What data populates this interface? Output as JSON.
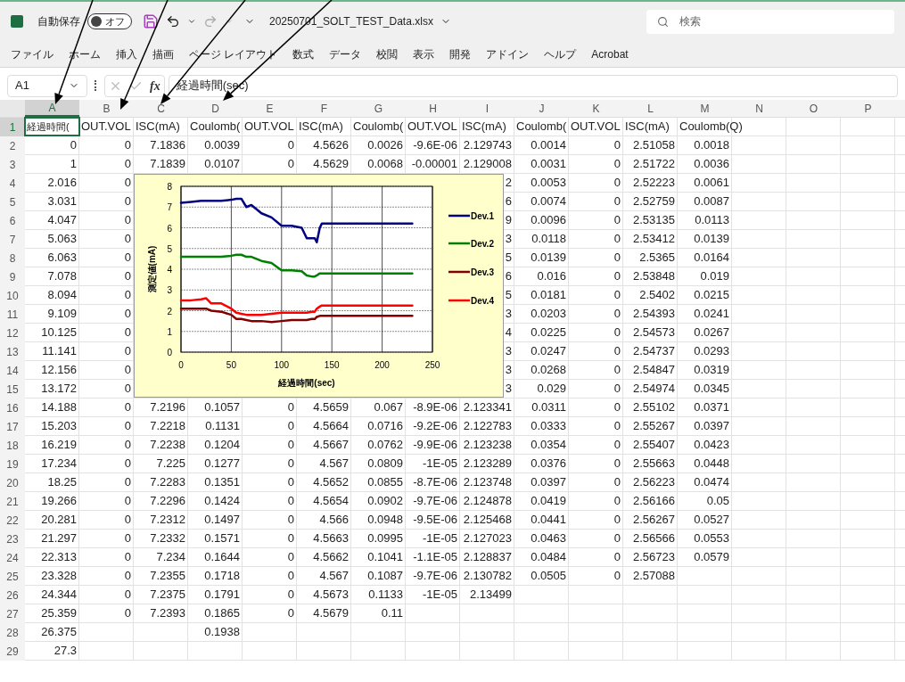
{
  "app": {
    "autosave_label": "自動保存",
    "autosave": {
      "on": false,
      "label": "オフ"
    },
    "file_name": "20250701_SOLT_TEST_Data.xlsx",
    "search_placeholder": "検索"
  },
  "menu": [
    "ファイル",
    "ホーム",
    "挿入",
    "描画",
    "ページ レイアウト",
    "数式",
    "データ",
    "校閲",
    "表示",
    "開発",
    "アドイン",
    "ヘルプ",
    "Acrobat"
  ],
  "formula_bar": {
    "cell_ref": "A1",
    "fx": "fx",
    "value": "経過時間(sec)"
  },
  "columns": [
    {
      "label": "A",
      "selected": true
    },
    {
      "label": "B",
      "selected": false
    },
    {
      "label": "C",
      "selected": false
    },
    {
      "label": "D",
      "selected": false
    },
    {
      "label": "E",
      "selected": false
    },
    {
      "label": "F",
      "selected": false
    },
    {
      "label": "G",
      "selected": false
    },
    {
      "label": "H",
      "selected": false
    },
    {
      "label": "I",
      "selected": false
    },
    {
      "label": "J",
      "selected": false
    },
    {
      "label": "K",
      "selected": false
    },
    {
      "label": "L",
      "selected": false
    },
    {
      "label": "M",
      "selected": false
    },
    {
      "label": "N",
      "selected": false
    },
    {
      "label": "O",
      "selected": false
    },
    {
      "label": "P",
      "selected": false
    }
  ],
  "rows": [
    {
      "label": "1",
      "selected": true,
      "kind": "header",
      "cells": [
        "経過時間(",
        "OUT.VOL",
        "ISC(mA)",
        "Coulomb(",
        "OUT.VOL",
        "ISC(mA)",
        "Coulomb(",
        "OUT.VOL",
        "ISC(mA)",
        "Coulomb(",
        "OUT.VOL",
        "ISC(mA)",
        "Coulomb(Q)"
      ]
    },
    {
      "label": "2",
      "selected": false,
      "kind": "data",
      "cells": [
        "0",
        "0",
        "7.1836",
        "0.0039",
        "0",
        "4.5626",
        "0.0026",
        "-9.6E-06",
        "2.129743",
        "0.0014",
        "0",
        "2.51058",
        "0.0018"
      ]
    },
    {
      "label": "3",
      "selected": false,
      "kind": "data",
      "cells": [
        "1",
        "0",
        "7.1839",
        "0.0107",
        "0",
        "4.5629",
        "0.0068",
        "-0.00001",
        "2.129008",
        "0.0031",
        "0",
        "2.51722",
        "0.0036"
      ]
    },
    {
      "label": "4",
      "selected": false,
      "kind": "data",
      "cells": [
        "2.016",
        "0",
        null,
        null,
        null,
        null,
        null,
        null,
        "2",
        "0.0053",
        "0",
        "2.52223",
        "0.0061"
      ]
    },
    {
      "label": "5",
      "selected": false,
      "kind": "data",
      "cells": [
        "3.031",
        "0",
        null,
        null,
        null,
        null,
        null,
        null,
        "6",
        "0.0074",
        "0",
        "2.52759",
        "0.0087"
      ]
    },
    {
      "label": "6",
      "selected": false,
      "kind": "data",
      "cells": [
        "4.047",
        "0",
        null,
        null,
        null,
        null,
        null,
        null,
        "9",
        "0.0096",
        "0",
        "2.53135",
        "0.0113"
      ]
    },
    {
      "label": "7",
      "selected": false,
      "kind": "data",
      "cells": [
        "5.063",
        "0",
        null,
        null,
        null,
        null,
        null,
        null,
        "3",
        "0.0118",
        "0",
        "2.53412",
        "0.0139"
      ]
    },
    {
      "label": "8",
      "selected": false,
      "kind": "data",
      "cells": [
        "6.063",
        "0",
        null,
        null,
        null,
        null,
        null,
        null,
        "5",
        "0.0139",
        "0",
        "2.5365",
        "0.0164"
      ]
    },
    {
      "label": "9",
      "selected": false,
      "kind": "data",
      "cells": [
        "7.078",
        "0",
        null,
        null,
        null,
        null,
        null,
        null,
        "6",
        "0.016",
        "0",
        "2.53848",
        "0.019"
      ]
    },
    {
      "label": "10",
      "selected": false,
      "kind": "data",
      "cells": [
        "8.094",
        "0",
        null,
        null,
        null,
        null,
        null,
        null,
        "5",
        "0.0181",
        "0",
        "2.5402",
        "0.0215"
      ]
    },
    {
      "label": "11",
      "selected": false,
      "kind": "data",
      "cells": [
        "9.109",
        "0",
        null,
        null,
        null,
        null,
        null,
        null,
        "3",
        "0.0203",
        "0",
        "2.54393",
        "0.0241"
      ]
    },
    {
      "label": "12",
      "selected": false,
      "kind": "data",
      "cells": [
        "10.125",
        "0",
        null,
        null,
        null,
        null,
        null,
        null,
        "4",
        "0.0225",
        "0",
        "2.54573",
        "0.0267"
      ]
    },
    {
      "label": "13",
      "selected": false,
      "kind": "data",
      "cells": [
        "11.141",
        "0",
        null,
        null,
        null,
        null,
        null,
        null,
        "3",
        "0.0247",
        "0",
        "2.54737",
        "0.0293"
      ]
    },
    {
      "label": "14",
      "selected": false,
      "kind": "data",
      "cells": [
        "12.156",
        "0",
        null,
        null,
        null,
        null,
        null,
        null,
        "3",
        "0.0268",
        "0",
        "2.54847",
        "0.0319"
      ]
    },
    {
      "label": "15",
      "selected": false,
      "kind": "data",
      "cells": [
        "13.172",
        "0",
        null,
        null,
        null,
        null,
        null,
        null,
        "3",
        "0.029",
        "0",
        "2.54974",
        "0.0345"
      ]
    },
    {
      "label": "16",
      "selected": false,
      "kind": "data",
      "cells": [
        "14.188",
        "0",
        "7.2196",
        "0.1057",
        "0",
        "4.5659",
        "0.067",
        "-8.9E-06",
        "2.123341",
        "0.0311",
        "0",
        "2.55102",
        "0.0371"
      ]
    },
    {
      "label": "17",
      "selected": false,
      "kind": "data",
      "cells": [
        "15.203",
        "0",
        "7.2218",
        "0.1131",
        "0",
        "4.5664",
        "0.0716",
        "-9.2E-06",
        "2.122783",
        "0.0333",
        "0",
        "2.55267",
        "0.0397"
      ]
    },
    {
      "label": "18",
      "selected": false,
      "kind": "data",
      "cells": [
        "16.219",
        "0",
        "7.2238",
        "0.1204",
        "0",
        "4.5667",
        "0.0762",
        "-9.9E-06",
        "2.123238",
        "0.0354",
        "0",
        "2.55407",
        "0.0423"
      ]
    },
    {
      "label": "19",
      "selected": false,
      "kind": "data",
      "cells": [
        "17.234",
        "0",
        "7.225",
        "0.1277",
        "0",
        "4.567",
        "0.0809",
        "-1E-05",
        "2.123289",
        "0.0376",
        "0",
        "2.55663",
        "0.0448"
      ]
    },
    {
      "label": "20",
      "selected": false,
      "kind": "data",
      "cells": [
        "18.25",
        "0",
        "7.2283",
        "0.1351",
        "0",
        "4.5652",
        "0.0855",
        "-8.7E-06",
        "2.123748",
        "0.0397",
        "0",
        "2.56223",
        "0.0474"
      ]
    },
    {
      "label": "21",
      "selected": false,
      "kind": "data",
      "cells": [
        "19.266",
        "0",
        "7.2296",
        "0.1424",
        "0",
        "4.5654",
        "0.0902",
        "-9.7E-06",
        "2.124878",
        "0.0419",
        "0",
        "2.56166",
        "0.05"
      ]
    },
    {
      "label": "22",
      "selected": false,
      "kind": "data",
      "cells": [
        "20.281",
        "0",
        "7.2312",
        "0.1497",
        "0",
        "4.566",
        "0.0948",
        "-9.5E-06",
        "2.125468",
        "0.0441",
        "0",
        "2.56267",
        "0.0527"
      ]
    },
    {
      "label": "23",
      "selected": false,
      "kind": "data",
      "cells": [
        "21.297",
        "0",
        "7.2332",
        "0.1571",
        "0",
        "4.5663",
        "0.0995",
        "-1E-05",
        "2.127023",
        "0.0463",
        "0",
        "2.56566",
        "0.0553"
      ]
    },
    {
      "label": "24",
      "selected": false,
      "kind": "data",
      "cells": [
        "22.313",
        "0",
        "7.234",
        "0.1644",
        "0",
        "4.5662",
        "0.1041",
        "-1.1E-05",
        "2.128837",
        "0.0484",
        "0",
        "2.56723",
        "0.0579"
      ]
    },
    {
      "label": "25",
      "selected": false,
      "kind": "data",
      "cells": [
        "23.328",
        "0",
        "7.2355",
        "0.1718",
        "0",
        "4.567",
        "0.1087",
        "-9.7E-06",
        "2.130782",
        "0.0505",
        "0",
        "2.57088"
      ]
    },
    {
      "label": "26",
      "selected": false,
      "kind": "data",
      "cells": [
        "24.344",
        "0",
        "7.2375",
        "0.1791",
        "0",
        "4.5673",
        "0.1133",
        "-1E-05",
        "2.13499"
      ]
    },
    {
      "label": "27",
      "selected": false,
      "kind": "data",
      "cells": [
        "25.359",
        "0",
        "7.2393",
        "0.1865",
        "0",
        "4.5679",
        "0.11"
      ]
    },
    {
      "label": "28",
      "selected": false,
      "kind": "data",
      "cells": [
        "26.375",
        null,
        null,
        "0.1938"
      ]
    },
    {
      "label": "29",
      "selected": false,
      "kind": "data",
      "cells": [
        "27.3"
      ]
    }
  ],
  "chart": {
    "chart_data": {
      "type": "line",
      "grid": true,
      "legend": true,
      "xlabel": "経過時間(sec)",
      "ylabel": "測定値(mA)",
      "xlim": [
        0,
        250
      ],
      "ylim": [
        0,
        8
      ],
      "xticks": [
        {
          "value": 0,
          "label": "0"
        },
        {
          "value": 50,
          "label": "50"
        },
        {
          "value": 100,
          "label": "100"
        },
        {
          "value": 150,
          "label": "150"
        },
        {
          "value": 200,
          "label": "200"
        },
        {
          "value": 250,
          "label": "250"
        }
      ],
      "yticks": [
        {
          "value": 0,
          "label": "0"
        },
        {
          "value": 1,
          "label": "1"
        },
        {
          "value": 2,
          "label": "2"
        },
        {
          "value": 3,
          "label": "3"
        },
        {
          "value": 4,
          "label": "4"
        },
        {
          "value": 5,
          "label": "5"
        },
        {
          "value": 6,
          "label": "6"
        },
        {
          "value": 7,
          "label": "7"
        },
        {
          "value": 8,
          "label": "8"
        }
      ],
      "x": [
        0,
        10,
        20,
        25,
        30,
        40,
        50,
        55,
        60,
        65,
        70,
        80,
        90,
        100,
        110,
        120,
        125,
        130,
        133,
        135,
        138,
        140,
        150,
        200,
        230
      ],
      "series": [
        {
          "name": "Dev.1",
          "color": "#000080",
          "values": [
            7.2,
            7.25,
            7.3,
            7.3,
            7.3,
            7.3,
            7.35,
            7.4,
            7.4,
            7.0,
            7.1,
            6.7,
            6.5,
            6.1,
            6.1,
            6.0,
            5.5,
            5.5,
            5.5,
            5.3,
            6.0,
            6.2,
            6.2,
            6.2,
            6.2
          ]
        },
        {
          "name": "Dev.2",
          "color": "#008000",
          "values": [
            4.6,
            4.6,
            4.6,
            4.6,
            4.6,
            4.6,
            4.65,
            4.7,
            4.7,
            4.6,
            4.6,
            4.4,
            4.3,
            3.95,
            3.95,
            3.9,
            3.7,
            3.65,
            3.65,
            3.7,
            3.8,
            3.8,
            3.8,
            3.8,
            3.8
          ]
        },
        {
          "name": "Dev.3",
          "color": "#800000",
          "values": [
            2.1,
            2.1,
            2.1,
            2.1,
            2.0,
            1.95,
            1.8,
            1.6,
            1.6,
            1.55,
            1.5,
            1.5,
            1.45,
            1.5,
            1.55,
            1.55,
            1.55,
            1.6,
            1.6,
            1.7,
            1.75,
            1.75,
            1.75,
            1.75,
            1.75
          ]
        },
        {
          "name": "Dev.4",
          "color": "#ff0000",
          "values": [
            2.5,
            2.5,
            2.55,
            2.6,
            2.35,
            2.35,
            2.1,
            1.9,
            1.85,
            1.8,
            1.8,
            1.8,
            1.85,
            1.9,
            1.9,
            1.9,
            1.9,
            1.95,
            1.95,
            2.1,
            2.2,
            2.25,
            2.25,
            2.25,
            2.25
          ]
        }
      ]
    }
  }
}
